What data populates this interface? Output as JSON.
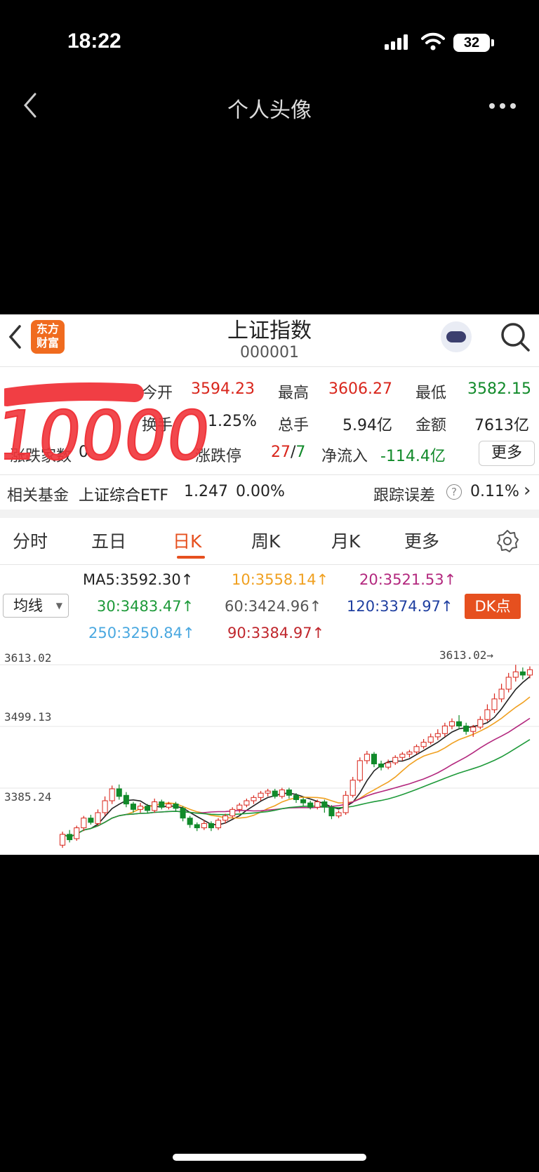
{
  "status_bar": {
    "time": "18:22",
    "battery": "32"
  },
  "nav": {
    "title": "个人头像"
  },
  "app": {
    "logo_line1": "东方",
    "logo_line2": "财富",
    "index_name": "上证指数",
    "index_code": "000001",
    "scribble_text": "10000"
  },
  "quote": {
    "open_label": "今开",
    "open": "3594.23",
    "high_label": "最高",
    "high": "3606.27",
    "low_label": "最低",
    "low": "3582.15",
    "turnover_label": "换手",
    "turnover": "1.25%",
    "volume_label": "总手",
    "volume": "5.94亿",
    "amount_label": "金额",
    "amount": "7613亿",
    "updown_label": "涨跌家数",
    "updown_prefix": "0",
    "limit_label": "涨跌停",
    "limit_up": "27",
    "limit_sep": "/",
    "limit_down": "7",
    "inflow_label": "净流入",
    "inflow": "-114.4亿",
    "more_label": "更多"
  },
  "fund": {
    "label": "相关基金",
    "name": "上证综合ETF",
    "price": "1.247",
    "change": "0.00%",
    "tracking_label": "跟踪误差",
    "help": "?",
    "tracking": "0.11%",
    "chevron": "›"
  },
  "tabs": [
    "分时",
    "五日",
    "日K",
    "周K",
    "月K",
    "更多"
  ],
  "ma": {
    "select_label": "均线",
    "dk_label": "DK点",
    "items": [
      {
        "text": "MA5:3592.30↑",
        "color": "#222222"
      },
      {
        "text": "10:3558.14↑",
        "color": "#f0a020"
      },
      {
        "text": "20:3521.53↑",
        "color": "#b3287e"
      },
      {
        "text": "30:3483.47↑",
        "color": "#1e9a3a"
      },
      {
        "text": "60:3424.96↑",
        "color": "#555555"
      },
      {
        "text": "120:3374.97↑",
        "color": "#1f3fa0"
      },
      {
        "text": "250:3250.84↑",
        "color": "#4aa8e0"
      },
      {
        "text": "90:3384.97↑",
        "color": "#c0272d"
      }
    ]
  },
  "chart_data": {
    "type": "candlestick",
    "y_labels": [
      "3613.02",
      "3499.13",
      "3385.24"
    ],
    "high_marker": "3613.02→",
    "ylim": [
      3270,
      3625
    ],
    "colors": {
      "up": "#d9261c",
      "down": "#118a2a"
    },
    "candles": [
      [
        3280,
        3300,
        3275,
        3305
      ],
      [
        3300,
        3290,
        3285,
        3308
      ],
      [
        3292,
        3312,
        3288,
        3316
      ],
      [
        3312,
        3330,
        3306,
        3334
      ],
      [
        3330,
        3322,
        3318,
        3336
      ],
      [
        3320,
        3340,
        3316,
        3346
      ],
      [
        3340,
        3362,
        3334,
        3370
      ],
      [
        3362,
        3384,
        3356,
        3390
      ],
      [
        3384,
        3370,
        3364,
        3392
      ],
      [
        3372,
        3356,
        3350,
        3378
      ],
      [
        3356,
        3346,
        3340,
        3360
      ],
      [
        3346,
        3352,
        3340,
        3358
      ],
      [
        3352,
        3344,
        3338,
        3356
      ],
      [
        3344,
        3360,
        3340,
        3366
      ],
      [
        3360,
        3350,
        3346,
        3364
      ],
      [
        3350,
        3356,
        3346,
        3360
      ],
      [
        3356,
        3348,
        3342,
        3360
      ],
      [
        3348,
        3330,
        3324,
        3352
      ],
      [
        3330,
        3318,
        3312,
        3334
      ],
      [
        3318,
        3312,
        3306,
        3322
      ],
      [
        3312,
        3320,
        3308,
        3326
      ],
      [
        3320,
        3312,
        3306,
        3324
      ],
      [
        3312,
        3326,
        3308,
        3330
      ],
      [
        3326,
        3334,
        3320,
        3338
      ],
      [
        3334,
        3346,
        3330,
        3350
      ],
      [
        3346,
        3354,
        3340,
        3358
      ],
      [
        3354,
        3362,
        3350,
        3366
      ],
      [
        3362,
        3368,
        3356,
        3372
      ],
      [
        3368,
        3376,
        3362,
        3380
      ],
      [
        3376,
        3380,
        3370,
        3384
      ],
      [
        3380,
        3370,
        3366,
        3384
      ],
      [
        3370,
        3382,
        3366,
        3386
      ],
      [
        3382,
        3372,
        3366,
        3386
      ],
      [
        3372,
        3364,
        3358,
        3376
      ],
      [
        3364,
        3358,
        3352,
        3368
      ],
      [
        3358,
        3350,
        3346,
        3362
      ],
      [
        3350,
        3360,
        3346,
        3364
      ],
      [
        3360,
        3350,
        3340,
        3364
      ],
      [
        3350,
        3334,
        3328,
        3354
      ],
      [
        3334,
        3340,
        3330,
        3344
      ],
      [
        3340,
        3372,
        3336,
        3380
      ],
      [
        3372,
        3400,
        3368,
        3406
      ],
      [
        3400,
        3436,
        3396,
        3442
      ],
      [
        3436,
        3448,
        3430,
        3454
      ],
      [
        3448,
        3430,
        3424,
        3452
      ],
      [
        3430,
        3424,
        3418,
        3436
      ],
      [
        3424,
        3432,
        3420,
        3438
      ],
      [
        3432,
        3442,
        3428,
        3446
      ],
      [
        3442,
        3448,
        3436,
        3452
      ],
      [
        3448,
        3452,
        3442,
        3456
      ],
      [
        3452,
        3462,
        3448,
        3466
      ],
      [
        3462,
        3470,
        3458,
        3476
      ],
      [
        3470,
        3480,
        3466,
        3486
      ],
      [
        3480,
        3486,
        3474,
        3494
      ],
      [
        3486,
        3500,
        3480,
        3506
      ],
      [
        3500,
        3508,
        3494,
        3514
      ],
      [
        3508,
        3500,
        3494,
        3520
      ],
      [
        3500,
        3490,
        3484,
        3506
      ],
      [
        3490,
        3498,
        3480,
        3502
      ],
      [
        3498,
        3512,
        3494,
        3518
      ],
      [
        3512,
        3530,
        3508,
        3540
      ],
      [
        3530,
        3550,
        3524,
        3560
      ],
      [
        3550,
        3568,
        3544,
        3578
      ],
      [
        3568,
        3590,
        3562,
        3598
      ],
      [
        3590,
        3600,
        3582,
        3613
      ],
      [
        3600,
        3594,
        3586,
        3608
      ],
      [
        3594,
        3604,
        3588,
        3610
      ]
    ]
  }
}
